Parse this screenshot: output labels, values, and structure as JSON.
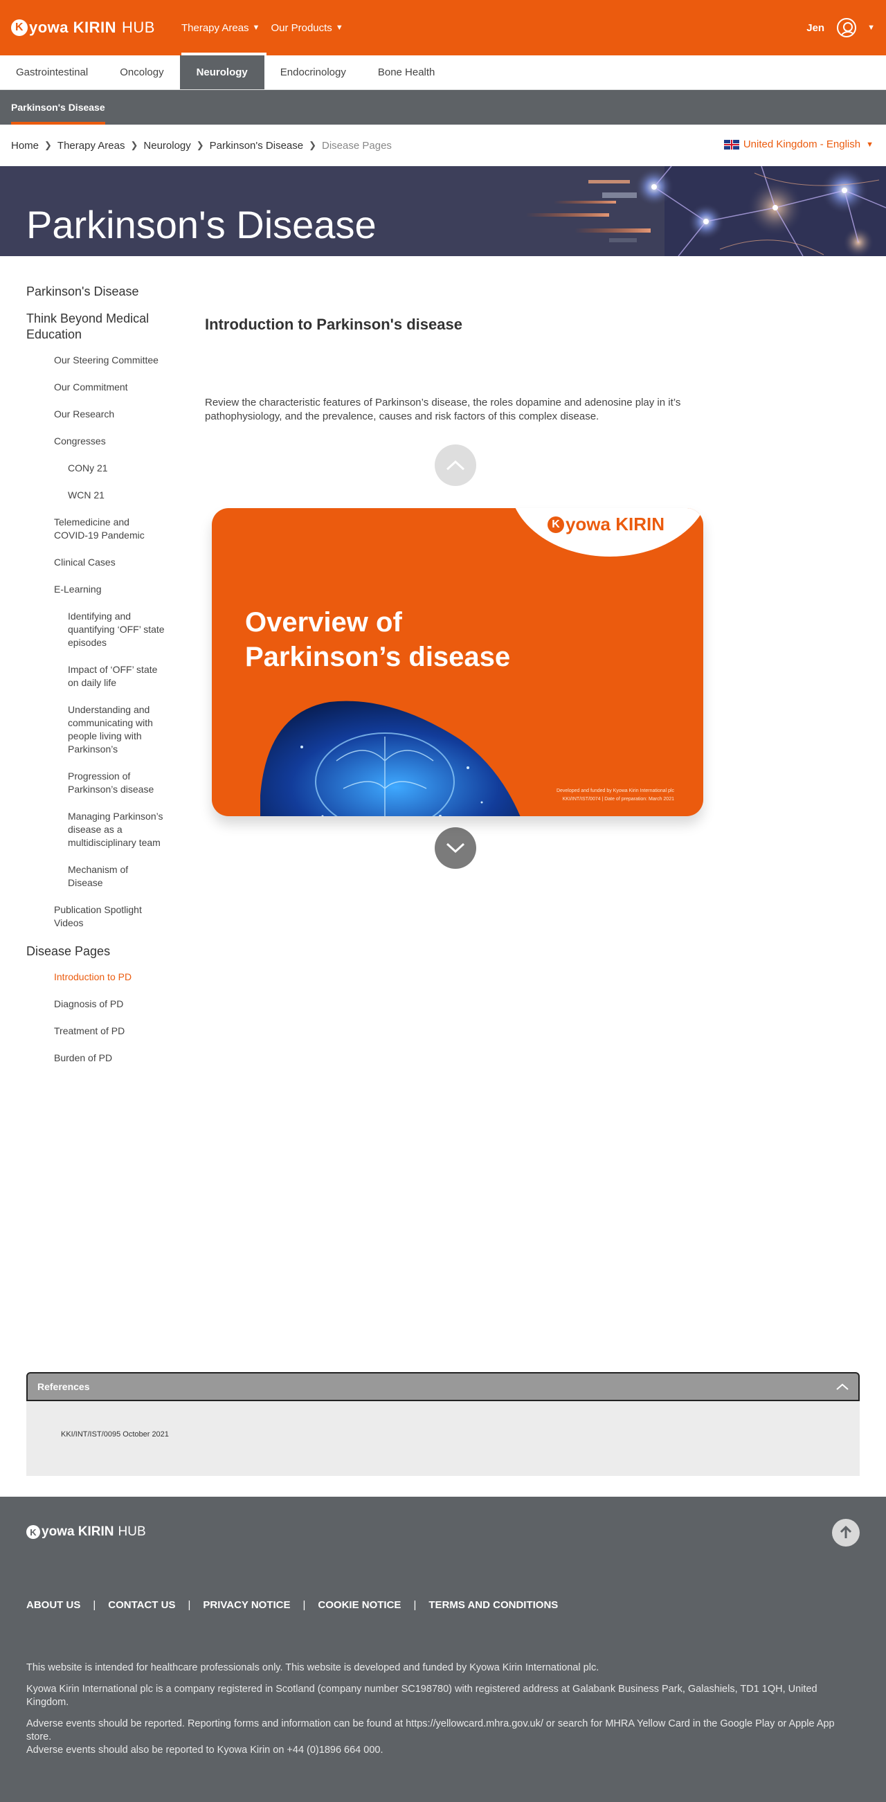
{
  "header": {
    "logo_mark": "K",
    "logo_text": "yowa KIRIN",
    "logo_suffix": "HUB",
    "nav": [
      {
        "label": "Therapy Areas"
      },
      {
        "label": "Our Products"
      }
    ],
    "user_name": "Jen"
  },
  "therapy_tabs": [
    "Gastrointestinal",
    "Oncology",
    "Neurology",
    "Endocrinology",
    "Bone Health"
  ],
  "subnav": {
    "label": "Parkinson's Disease"
  },
  "breadcrumb": [
    "Home",
    "Therapy Areas",
    "Neurology",
    "Parkinson's Disease",
    "Disease Pages"
  ],
  "locale": {
    "label": "United Kingdom - English"
  },
  "hero": {
    "title": "Parkinson's Disease"
  },
  "sidebar": {
    "items": [
      {
        "level": 1,
        "label": "Parkinson's Disease"
      },
      {
        "level": 1,
        "label": "Think Beyond Medical Education"
      },
      {
        "level": 2,
        "label": "Our Steering Committee"
      },
      {
        "level": 2,
        "label": "Our Commitment"
      },
      {
        "level": 2,
        "label": "Our Research"
      },
      {
        "level": 2,
        "label": "Congresses"
      },
      {
        "level": 3,
        "label": "CONy 21"
      },
      {
        "level": 3,
        "label": "WCN 21"
      },
      {
        "level": 2,
        "label": "Telemedicine and COVID-19 Pandemic"
      },
      {
        "level": 2,
        "label": "Clinical Cases"
      },
      {
        "level": 2,
        "label": "E-Learning"
      },
      {
        "level": 3,
        "label": "Identifying and quantifying ‘OFF’ state episodes"
      },
      {
        "level": 3,
        "label": "Impact of ‘OFF’ state on daily life"
      },
      {
        "level": 3,
        "label": "Understanding and communicating with people living with Parkinson’s"
      },
      {
        "level": 3,
        "label": "Progression of Parkinson’s disease"
      },
      {
        "level": 3,
        "label": "Managing Parkinson’s disease as a multidisciplinary team"
      },
      {
        "level": 3,
        "label": "Mechanism of Disease"
      },
      {
        "level": 2,
        "label": "Publication Spotlight Videos"
      },
      {
        "level": 1,
        "label": "Disease Pages"
      },
      {
        "level": 2,
        "label": "Introduction to PD",
        "active": true
      },
      {
        "level": 2,
        "label": "Diagnosis of PD"
      },
      {
        "level": 2,
        "label": "Treatment of PD"
      },
      {
        "level": 2,
        "label": "Burden of PD"
      }
    ]
  },
  "main": {
    "title": "Introduction to Parkinson's disease",
    "description": "Review the characteristic features of Parkinson’s disease, the roles dopamine and adenosine play in it’s pathophysiology, and the prevalence, causes and risk factors of this complex disease.",
    "slide": {
      "logo_mark": "K",
      "logo_text": "yowa KIRIN",
      "title": "Overview of Parkinson’s disease",
      "fine_line1": "Developed and funded by Kyowa Kirin International plc",
      "fine_line2": "KKI/INT/IST/0074 | Date of preparation: March 2021"
    }
  },
  "references": {
    "title": "References",
    "code": "KKI/INT/IST/0095 October 2021"
  },
  "footer": {
    "logo_mark": "K",
    "logo_text": "yowa KIRIN",
    "logo_suffix": "HUB",
    "links": [
      "ABOUT US",
      "CONTACT US",
      "PRIVACY NOTICE",
      "COOKIE NOTICE",
      "TERMS AND CONDITIONS"
    ],
    "text1": "This website is intended for healthcare professionals only. This website is developed and funded by Kyowa Kirin International plc.",
    "text2": "Kyowa Kirin International plc is a company registered in Scotland (company number SC198780) with registered address at Galabank Business Park, Galashiels, TD1 1QH, United Kingdom.",
    "text3a": "Adverse events should be reported. Reporting forms and information can be found at https://yellowcard.mhra.gov.uk/ or search for MHRA Yellow Card in the Google Play or Apple App store.",
    "text3b": "Adverse events should also be reported to Kyowa Kirin on +44 (0)1896 664 000."
  },
  "colors": {
    "brand_orange": "#eb5b0e",
    "dark_grey": "#5e6266",
    "hero_navy": "#3d3f5a"
  },
  "icons": [
    "chevron-right-icon",
    "user-icon",
    "uk-flag-icon",
    "chevron-up-icon",
    "chevron-down-icon",
    "arrow-up-icon"
  ]
}
